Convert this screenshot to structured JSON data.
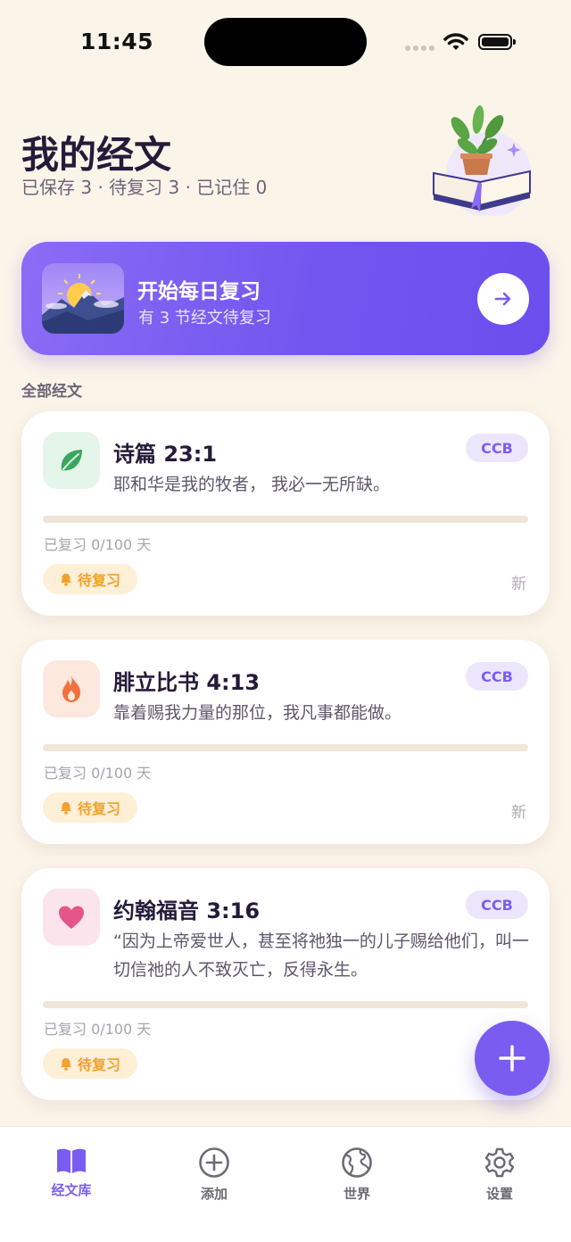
{
  "status_bar": {
    "time": "11:45"
  },
  "header": {
    "title": "我的经文",
    "stats": "已保存 3 · 待复习 3 · 已记住 0"
  },
  "daily_review": {
    "title": "开始每日复习",
    "subtitle": "有 3 节经文待复习"
  },
  "section_label": "全部经文",
  "verses": [
    {
      "reference": "诗篇 23:1",
      "translation": "CCB",
      "text": "耶和华是我的牧者， 我必一无所缺。",
      "progress": "已复习 0/100 天",
      "progress_fraction": 0,
      "status": "待复习",
      "tag": "新",
      "icon": "leaf-icon",
      "icon_bg": "#e4f5ea",
      "icon_color": "#3aa65b"
    },
    {
      "reference": "腓立比书 4:13",
      "translation": "CCB",
      "text": "靠着赐我力量的那位，我凡事都能做。",
      "progress": "已复习 0/100 天",
      "progress_fraction": 0,
      "status": "待复习",
      "tag": "新",
      "icon": "flame-icon",
      "icon_bg": "#fde8de",
      "icon_color": "#f2703d"
    },
    {
      "reference": "约翰福音 3:16",
      "translation": "CCB",
      "text": "“因为上帝爱世人，甚至将祂独一的儿子赐给他们，叫一切信祂的人不致灭亡，反得永生。",
      "progress": "已复习 0/100 天",
      "progress_fraction": 0,
      "status": "待复习",
      "tag": "",
      "icon": "heart-icon",
      "icon_bg": "#fce4ec",
      "icon_color": "#e45589"
    }
  ],
  "tabbar": {
    "library": "经文库",
    "add": "添加",
    "world": "世界",
    "settings": "设置"
  },
  "colors": {
    "accent": "#7a5cf1",
    "background": "#fbf4e9",
    "due_badge": "#f2a12b"
  }
}
